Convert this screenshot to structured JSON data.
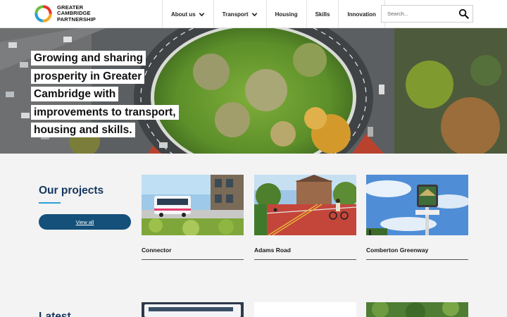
{
  "header": {
    "logo": {
      "line1": "GREATER",
      "line2": "CAMBRIDGE",
      "line3": "PARTNERSHIP"
    },
    "nav": [
      {
        "label": "About us",
        "has_dropdown": true
      },
      {
        "label": "Transport",
        "has_dropdown": true
      },
      {
        "label": "Housing",
        "has_dropdown": false
      },
      {
        "label": "Skills",
        "has_dropdown": false
      },
      {
        "label": "Innovation",
        "has_dropdown": false
      }
    ],
    "search": {
      "placeholder": "Search...",
      "value": "",
      "icon": "search-icon"
    }
  },
  "hero": {
    "lines": [
      "Growing and sharing",
      "prosperity in Greater",
      "Cambridge with",
      "improvements to transport,",
      "housing and skills."
    ]
  },
  "projects": {
    "heading": "Our projects",
    "view_all_label": "View all",
    "cards": [
      {
        "title": "Connector"
      },
      {
        "title": "Adams Road"
      },
      {
        "title": "Comberton Greenway"
      }
    ]
  },
  "latest": {
    "heading": "Latest"
  },
  "colors": {
    "brand_navy": "#14365f",
    "button_blue": "#14507a",
    "accent_blue": "#2a9fd6",
    "page_bg": "#f3f3f3"
  }
}
